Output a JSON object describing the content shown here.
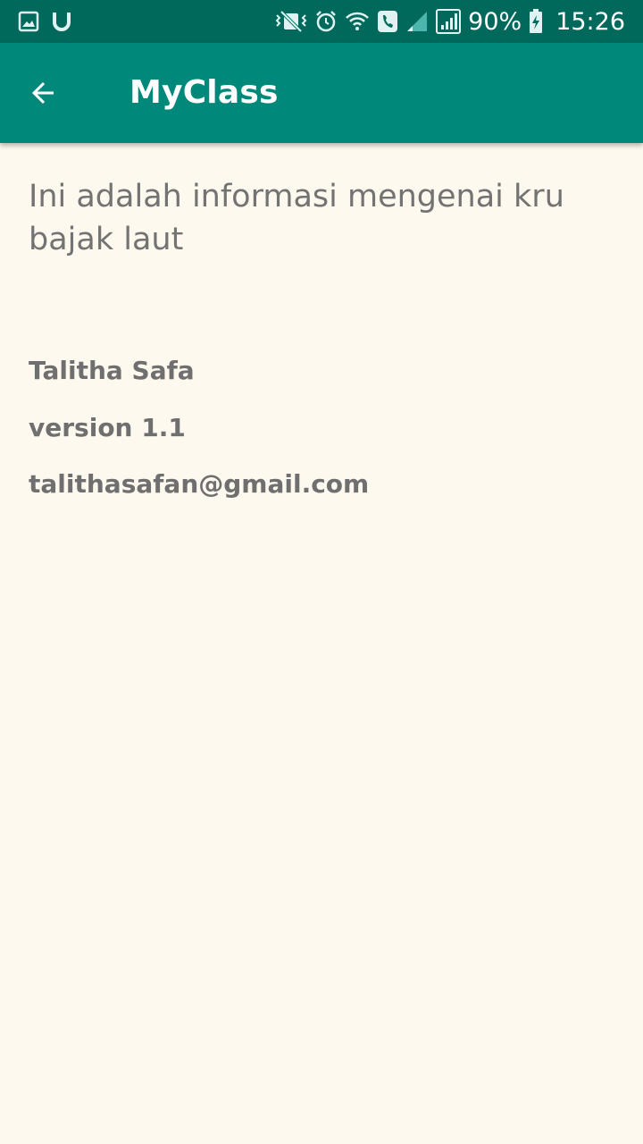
{
  "status_bar": {
    "battery_percent": "90%",
    "time": "15:26",
    "left_icons": [
      "gallery-icon",
      "magnet-icon"
    ],
    "right_icons": [
      "vibrate-icon",
      "alarm-icon",
      "wifi-icon",
      "call-icon",
      "signal-icon",
      "signal-full-icon",
      "battery-charging-icon"
    ]
  },
  "app_bar": {
    "title": "MyClass",
    "back_icon": "arrow-back-icon"
  },
  "main": {
    "description": "Ini adalah informasi mengenai kru bajak laut",
    "author_name": "Talitha Safa",
    "version": "version 1.1",
    "email": "talithasafan@gmail.com"
  },
  "colors": {
    "status_bar": "#00695c",
    "app_bar": "#00897b",
    "background": "#fdf9ef",
    "text": "#737373"
  }
}
